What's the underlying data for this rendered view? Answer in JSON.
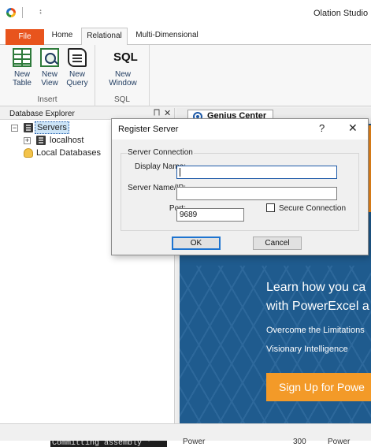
{
  "window": {
    "title": "Olation Studio",
    "qat_dropdown_icon": "⨟"
  },
  "ribbon": {
    "tabs": [
      {
        "label": "File"
      },
      {
        "label": "Home"
      },
      {
        "label": "Relational"
      },
      {
        "label": "Multi-Dimensional"
      }
    ],
    "active_tab": "Relational",
    "groups": {
      "insert": {
        "label": "Insert",
        "buttons": [
          {
            "label": "New Table",
            "icon": "table-icon"
          },
          {
            "label": "New View",
            "icon": "view-icon"
          },
          {
            "label": "New Query",
            "icon": "query-icon"
          }
        ]
      },
      "sql": {
        "label": "SQL",
        "icon_text": "SQL",
        "buttons": [
          {
            "label": "New Window",
            "icon": "sql-icon"
          }
        ]
      }
    }
  },
  "explorer": {
    "title": "Database Explorer",
    "pin_glyph": "⨅",
    "close_glyph": "✕",
    "tree": [
      {
        "label": "Servers",
        "toggle": "−",
        "selected": true
      },
      {
        "label": "localhost",
        "toggle": "+"
      },
      {
        "label": "Local Databases"
      }
    ]
  },
  "document": {
    "tab_label": "Genius Center",
    "promo": {
      "title_line1": "Learn how you ca",
      "title_line2": "with PowerExcel a",
      "line1": "Overcome the Limitations",
      "line2": "Visionary Intelligence",
      "button": "Sign Up for Powe"
    },
    "colors": {
      "panel": "#1f5b8e",
      "accent": "#f39a28"
    }
  },
  "dialog": {
    "title": "Register Server",
    "help_glyph": "?",
    "close_glyph": "✕",
    "group_title": "Server Connection",
    "display_name_label": "Display Name:",
    "display_name_value": "",
    "server_name_label": "Server Name/IP:",
    "server_name_value": "",
    "port_label": "Port:",
    "port_value": "9689",
    "secure_label": "Secure Connection",
    "secure_checked": false,
    "ok_label": "OK",
    "cancel_label": "Cancel"
  },
  "background": {
    "console_text": "Committing assembly '",
    "text_1": "Power",
    "text_2": "300",
    "text_3": "Power"
  }
}
